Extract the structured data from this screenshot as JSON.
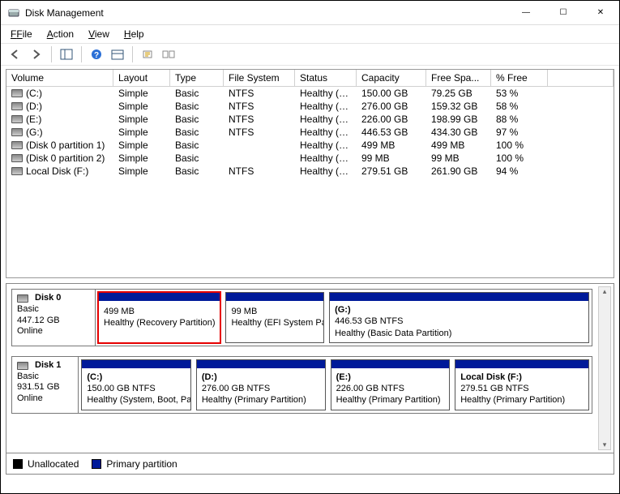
{
  "window": {
    "title": "Disk Management",
    "controls": {
      "min": "—",
      "max": "☐",
      "close": "✕"
    }
  },
  "menu": {
    "file": "File",
    "action": "Action",
    "view": "View",
    "help": "Help"
  },
  "toolbar": {
    "back": "back-icon",
    "forward": "forward-icon",
    "show_hide": "show-hide-icon",
    "help": "help-icon",
    "props": "properties-icon",
    "refresh": "refresh-icon",
    "settings": "settings-icon"
  },
  "volumes": {
    "headers": {
      "volume": "Volume",
      "layout": "Layout",
      "type": "Type",
      "fs": "File System",
      "status": "Status",
      "capacity": "Capacity",
      "free": "Free Spa...",
      "pct": "% Free"
    },
    "rows": [
      {
        "volume": "(C:)",
        "layout": "Simple",
        "type": "Basic",
        "fs": "NTFS",
        "status": "Healthy (S...",
        "capacity": "150.00 GB",
        "free": "79.25 GB",
        "pct": "53 %"
      },
      {
        "volume": "(D:)",
        "layout": "Simple",
        "type": "Basic",
        "fs": "NTFS",
        "status": "Healthy (P...",
        "capacity": "276.00 GB",
        "free": "159.32 GB",
        "pct": "58 %"
      },
      {
        "volume": "(E:)",
        "layout": "Simple",
        "type": "Basic",
        "fs": "NTFS",
        "status": "Healthy (P...",
        "capacity": "226.00 GB",
        "free": "198.99 GB",
        "pct": "88 %"
      },
      {
        "volume": "(G:)",
        "layout": "Simple",
        "type": "Basic",
        "fs": "NTFS",
        "status": "Healthy (B...",
        "capacity": "446.53 GB",
        "free": "434.30 GB",
        "pct": "97 %"
      },
      {
        "volume": "(Disk 0 partition 1)",
        "layout": "Simple",
        "type": "Basic",
        "fs": "",
        "status": "Healthy (R...",
        "capacity": "499 MB",
        "free": "499 MB",
        "pct": "100 %"
      },
      {
        "volume": "(Disk 0 partition 2)",
        "layout": "Simple",
        "type": "Basic",
        "fs": "",
        "status": "Healthy (E...",
        "capacity": "99 MB",
        "free": "99 MB",
        "pct": "100 %"
      },
      {
        "volume": "Local Disk (F:)",
        "layout": "Simple",
        "type": "Basic",
        "fs": "NTFS",
        "status": "Healthy (P...",
        "capacity": "279.51 GB",
        "free": "261.90 GB",
        "pct": "94 %"
      }
    ]
  },
  "disks": [
    {
      "name": "Disk 0",
      "type": "Basic",
      "size": "447.12 GB",
      "state": "Online",
      "partitions": [
        {
          "letter": "",
          "size": "499 MB",
          "status": "Healthy (Recovery Partition)",
          "flex": 1.5,
          "highlight": true
        },
        {
          "letter": "",
          "size": "99 MB",
          "status": "Healthy (EFI System Partition)",
          "flex": 1.2,
          "highlight": false
        },
        {
          "letter": "(G:)",
          "size": "446.53 GB NTFS",
          "status": "Healthy (Basic Data Partition)",
          "flex": 3.2,
          "highlight": false
        }
      ]
    },
    {
      "name": "Disk 1",
      "type": "Basic",
      "size": "931.51 GB",
      "state": "Online",
      "partitions": [
        {
          "letter": "(C:)",
          "size": "150.00 GB NTFS",
          "status": "Healthy (System, Boot, Page File)",
          "flex": 1.1,
          "highlight": false
        },
        {
          "letter": "(D:)",
          "size": "276.00 GB NTFS",
          "status": "Healthy (Primary Partition)",
          "flex": 1.3,
          "highlight": false
        },
        {
          "letter": "(E:)",
          "size": "226.00 GB NTFS",
          "status": "Healthy (Primary Partition)",
          "flex": 1.2,
          "highlight": false
        },
        {
          "letter": "Local Disk  (F:)",
          "size": "279.51 GB NTFS",
          "status": "Healthy (Primary Partition)",
          "flex": 1.35,
          "highlight": false
        }
      ]
    }
  ],
  "legend": {
    "unallocated": "Unallocated",
    "primary": "Primary partition"
  }
}
